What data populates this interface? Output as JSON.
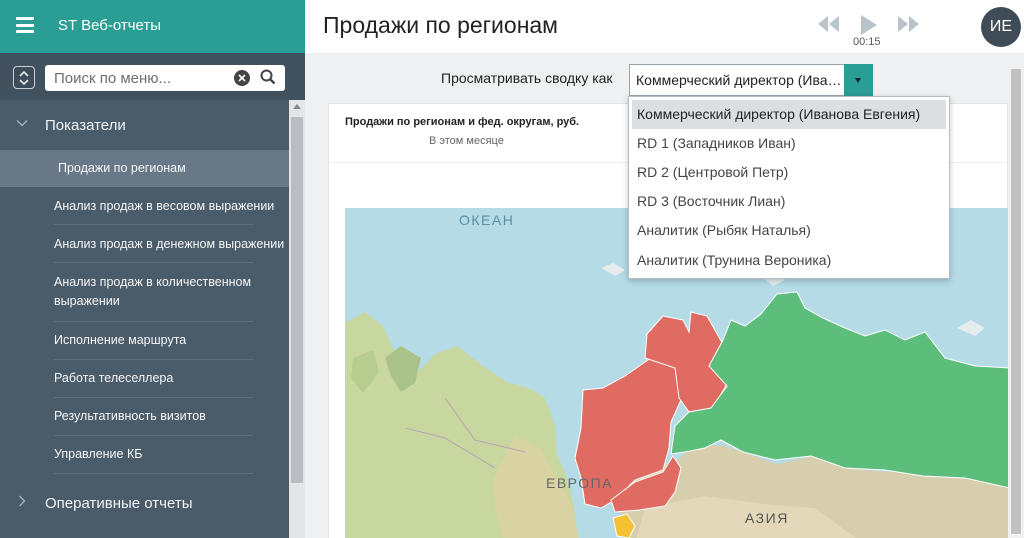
{
  "app": {
    "title": "ST Веб-отчеты"
  },
  "search": {
    "placeholder": "Поиск по меню..."
  },
  "sidebar": {
    "sections": [
      {
        "label": "Показатели",
        "expanded": true
      },
      {
        "label": "Оперативные отчеты",
        "expanded": false
      }
    ],
    "items": [
      {
        "label": "Продажи по регионам",
        "active": true
      },
      {
        "label": "Анализ продаж в весовом выражении"
      },
      {
        "label": "Анализ продаж в денежном выражении"
      },
      {
        "label": "Анализ продаж в количественном выражении"
      },
      {
        "label": "Исполнение маршрута"
      },
      {
        "label": "Работа телеселлера"
      },
      {
        "label": "Результативность визитов"
      },
      {
        "label": "Управление КБ"
      }
    ]
  },
  "header": {
    "title": "Продажи по регионам",
    "time": "00:15",
    "avatar_initials": "ИЕ"
  },
  "viewer": {
    "label": "Просматривать сводку как",
    "selected": "Коммерческий директор (Иванова Евгения)",
    "options": [
      "Коммерческий директор (Иванова Евгения)",
      "RD 1 (Западников Иван)",
      "RD 2 (Центровой Петр)",
      "RD 3 (Восточник Лиан)",
      "Аналитик (Рыбяк Наталья)",
      "Аналитик (Трунина Вероника)"
    ]
  },
  "card": {
    "title": "Продажи по регионам и фед. округам, руб.",
    "subtitle": "В этом месяце",
    "map_labels": {
      "ocean": "ОКЕАН",
      "europe": "ЕВРОПА",
      "asia": "АЗИЯ"
    }
  },
  "colors": {
    "brand": "#2a9d94",
    "sidebar": "#4a5b6a",
    "region_red": "#e06b62",
    "region_green": "#5dbd7b",
    "region_yellow": "#f3c131"
  }
}
